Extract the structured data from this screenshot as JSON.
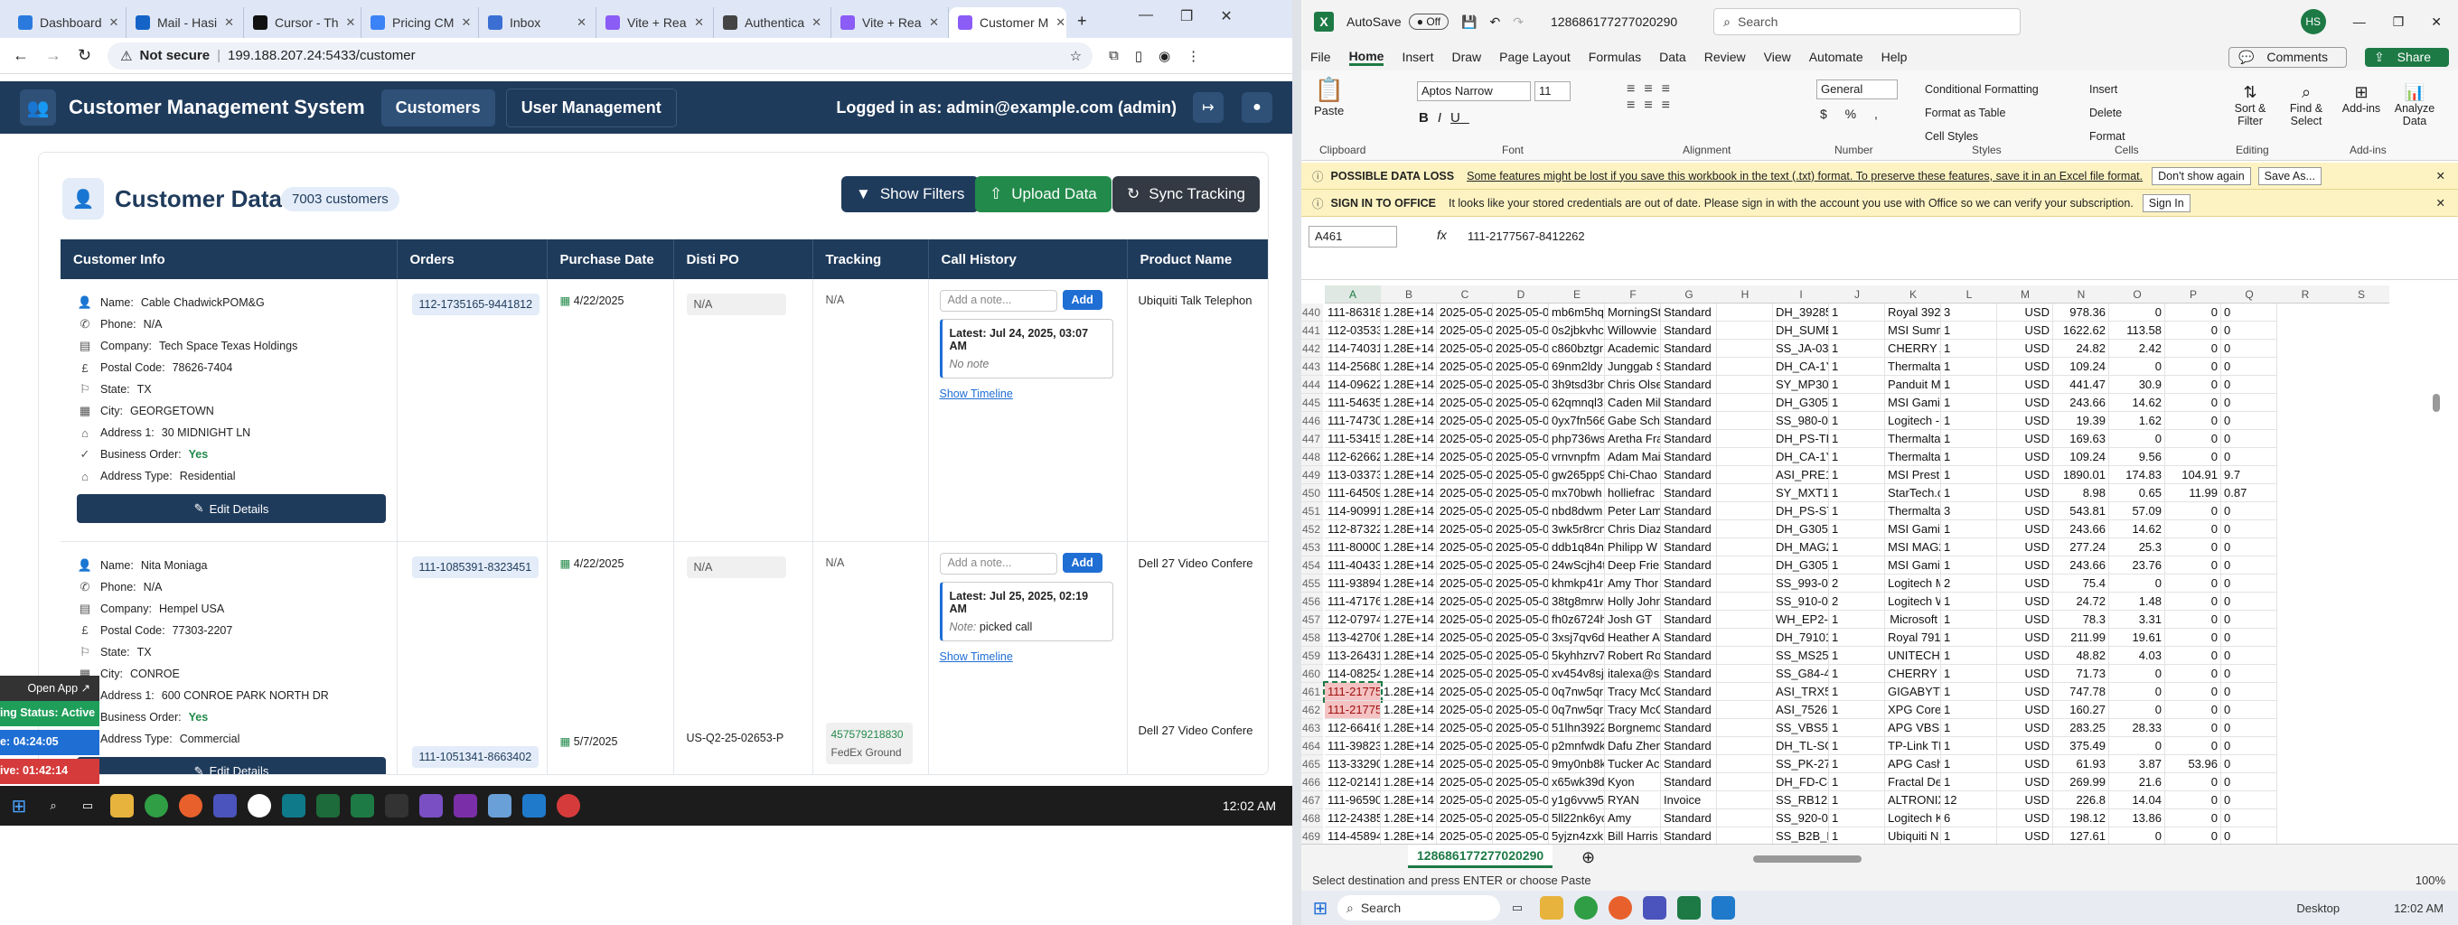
{
  "browser": {
    "tabs": [
      {
        "label": "Dashboard",
        "color": "#2a7ade"
      },
      {
        "label": "Mail - Hasi",
        "color": "#1464c8"
      },
      {
        "label": "Cursor - Th",
        "color": "#111111"
      },
      {
        "label": "Pricing CM",
        "color": "#3b82f6"
      },
      {
        "label": "Inbox",
        "color": "#3b6fd4"
      },
      {
        "label": "Vite + Rea",
        "color": "#8b5cf6"
      },
      {
        "label": "Authentica",
        "color": "#444444"
      },
      {
        "label": "Vite + Rea",
        "color": "#8b5cf6"
      },
      {
        "label": "Customer M",
        "color": "#8b5cf6"
      }
    ],
    "not_secure": "Not secure",
    "url": "199.188.207.24:5433/customer"
  },
  "app": {
    "title": "Customer Management System",
    "nav": [
      "Customers",
      "User Management"
    ],
    "logged_in": "Logged in as: admin@example.com (admin)"
  },
  "page": {
    "title": "Customer Data",
    "count": "7003 customers",
    "buttons": {
      "filters": "Show Filters",
      "upload": "Upload Data",
      "sync": "Sync Tracking"
    },
    "columns": [
      "Customer Info",
      "Orders",
      "Purchase Date",
      "Disti PO",
      "Tracking",
      "Call History",
      "Product Name"
    ],
    "note_placeholder": "Add a note...",
    "add_label": "Add",
    "latest_label": "Latest:",
    "show_timeline": "Show Timeline",
    "edit_label": "Edit Details",
    "field_labels": [
      "Name:",
      "Phone:",
      "Company:",
      "Postal Code:",
      "State:",
      "City:",
      "Address 1:",
      "Business Order:",
      "Address Type:"
    ],
    "rows": [
      {
        "name": "Cable ChadwickPOM&G",
        "phone": "N/A",
        "company": "Tech Space Texas Holdings",
        "postal": "78626-7404",
        "state": "TX",
        "city": "GEORGETOWN",
        "address": "30 MIDNIGHT LN",
        "business": "Yes",
        "addrtype": "Residential",
        "order": "112-1735165-9441812",
        "date": "4/22/2025",
        "disti": "N/A",
        "tracking": "N/A",
        "latest_date": "Jul 24, 2025, 03:07 AM",
        "latest_note": "No note",
        "product": "Ubiquiti Talk Telephon"
      },
      {
        "name": "Nita Moniaga",
        "phone": "N/A",
        "company": "Hempel USA",
        "postal": "77303-2207",
        "state": "TX",
        "city": "CONROE",
        "address": "600 CONROE PARK NORTH DR",
        "business": "Yes",
        "addrtype": "Commercial",
        "order": "111-1085391-8323451",
        "date": "4/22/2025",
        "disti": "N/A",
        "tracking": "N/A",
        "latest_date": "Jul 25, 2025, 02:19 AM",
        "latest_note_label": "Note:",
        "latest_note": "picked call",
        "product": "Dell 27 Video Confere",
        "order2": "111-1051341-8663402",
        "date2": "5/7/2025",
        "disti2": "US-Q2-25-02653-P",
        "tracking2": "457579218830",
        "carrier2": "FedEx Ground",
        "product2": "Dell 27 Video Confere"
      }
    ]
  },
  "overlay": {
    "open_app": "Open App",
    "status": "ing Status: Active",
    "t1": "e: 04:24:05",
    "t2": "ive: 01:42:14"
  },
  "taskbar_time": "12:02 AM",
  "excel": {
    "autosave": "AutoSave",
    "toggle": "Off",
    "filename": "128686177277020290",
    "search": "Search",
    "user": "HS",
    "menu": [
      "File",
      "Home",
      "Insert",
      "Draw",
      "Page Layout",
      "Formulas",
      "Data",
      "Review",
      "View",
      "Automate",
      "Help"
    ],
    "comments": "Comments",
    "share": "Share",
    "font": "Aptos Narrow",
    "size": "11",
    "numfmt": "General",
    "groups": [
      "Clipboard",
      "Font",
      "Alignment",
      "Number",
      "Styles",
      "Cells",
      "Editing",
      "Add-ins"
    ],
    "styles": [
      "Conditional Formatting",
      "Format as Table",
      "Cell Styles"
    ],
    "cells": [
      "Insert",
      "Delete",
      "Format"
    ],
    "editing": [
      "Sort & Filter",
      "Find & Select"
    ],
    "addins": [
      "Add-ins",
      "Analyze Data"
    ],
    "paste": "Paste",
    "msg1": {
      "title": "POSSIBLE DATA LOSS",
      "text": "Some features might be lost if you save this workbook in the text (.txt) format. To preserve these features, save it in an Excel file format.",
      "b1": "Don't show again",
      "b2": "Save As..."
    },
    "msg2": {
      "title": "SIGN IN TO OFFICE",
      "text": "It looks like your stored credentials are out of date. Please sign in with the account you use with Office so we can verify your subscription.",
      "b1": "Sign In"
    },
    "namebox": "A461",
    "formula": "111-2177567-8412262",
    "col_letters": [
      "A",
      "B",
      "C",
      "D",
      "E",
      "F",
      "G",
      "H",
      "I",
      "J",
      "K",
      "L",
      "M",
      "N",
      "O",
      "P",
      "Q",
      "R",
      "S"
    ],
    "rows": [
      [
        "440",
        "111-86318",
        "1.28E+14",
        "2025-05-0",
        "2025-05-0",
        "mb6m5hq",
        "MorningSt",
        "Standard",
        "",
        "DH_39285",
        "1",
        "Royal 392",
        "3",
        "USD",
        "978.36",
        "0",
        "0",
        "0"
      ],
      [
        "441",
        "112-03533",
        "1.28E+14",
        "2025-05-0",
        "2025-05-0",
        "0s2jbkvhc",
        "Willowvie",
        "Standard",
        "",
        "DH_SUME",
        "1",
        "MSI Summ",
        "1",
        "USD",
        "1622.62",
        "113.58",
        "0",
        "0"
      ],
      [
        "442",
        "114-74031",
        "1.28E+14",
        "2025-05-0",
        "2025-05-0",
        "c860bztgr",
        "Academic",
        "Standard",
        "",
        "SS_JA-033",
        "1",
        "CHERRY A",
        "1",
        "USD",
        "24.82",
        "2.42",
        "0",
        "0"
      ],
      [
        "443",
        "114-25680",
        "1.28E+14",
        "2025-05-0",
        "2025-05-0",
        "69nm2ldy",
        "Junggab S",
        "Standard",
        "",
        "DH_CA-1Y",
        "1",
        "Thermalta",
        "1",
        "USD",
        "109.24",
        "0",
        "0",
        "0"
      ],
      [
        "444",
        "114-09622",
        "1.28E+14",
        "2025-05-0",
        "2025-05-0",
        "3h9tsd3br",
        "Chris Olse",
        "Standard",
        "",
        "SY_MP300",
        "1",
        "Panduit M",
        "1",
        "USD",
        "441.47",
        "30.9",
        "0",
        "0"
      ],
      [
        "445",
        "111-54635",
        "1.28E+14",
        "2025-05-0",
        "2025-05-0",
        "62qmnql3",
        "Caden Mil",
        "Standard",
        "",
        "DH_G3050",
        "1",
        "MSI Gamin",
        "1",
        "USD",
        "243.66",
        "14.62",
        "0",
        "0"
      ],
      [
        "446",
        "111-74730",
        "1.28E+14",
        "2025-05-0",
        "2025-05-0",
        "0yx7fn566",
        "Gabe Sch",
        "Standard",
        "",
        "SS_980-00",
        "1",
        "Logitech -",
        "1",
        "USD",
        "19.39",
        "1.62",
        "0",
        "0"
      ],
      [
        "447",
        "111-53415",
        "1.28E+14",
        "2025-05-0",
        "2025-05-0",
        "php736ws",
        "Aretha Fra",
        "Standard",
        "",
        "DH_PS-TP",
        "1",
        "Thermalta",
        "1",
        "USD",
        "169.63",
        "0",
        "0",
        "0"
      ],
      [
        "448",
        "112-62662",
        "1.28E+14",
        "2025-05-0",
        "2025-05-0",
        "vrnvnpfm",
        "Adam Mai",
        "Standard",
        "",
        "DH_CA-1Y",
        "1",
        "Thermalta",
        "1",
        "USD",
        "109.24",
        "9.56",
        "0",
        "0"
      ],
      [
        "449",
        "113-03373",
        "1.28E+14",
        "2025-05-0",
        "2025-05-0",
        "gw265pp9",
        "Chi-Chao",
        "Standard",
        "",
        "ASI_PRE16",
        "1",
        "MSI Presti",
        "1",
        "USD",
        "1890.01",
        "174.83",
        "104.91",
        "9.7"
      ],
      [
        "450",
        "111-64509",
        "1.28E+14",
        "2025-05-0",
        "2025-05-0",
        "mx70bwh",
        "holliefrac",
        "Standard",
        "",
        "SY_MXT10",
        "1",
        "StarTech.c",
        "1",
        "USD",
        "8.98",
        "0.65",
        "11.99",
        "0.87"
      ],
      [
        "451",
        "114-90991",
        "1.28E+14",
        "2025-05-0",
        "2025-05-0",
        "nbd8dwm",
        "Peter Lam",
        "Standard",
        "",
        "DH_PS-STI",
        "1",
        "Thermalta",
        "3",
        "USD",
        "543.81",
        "57.09",
        "0",
        "0"
      ],
      [
        "452",
        "112-87322",
        "1.28E+14",
        "2025-05-0",
        "2025-05-0",
        "3wk5r8rcn",
        "Chris Diaz",
        "Standard",
        "",
        "DH_G3050",
        "1",
        "MSI Gamin",
        "1",
        "USD",
        "243.66",
        "14.62",
        "0",
        "0"
      ],
      [
        "453",
        "111-80000",
        "1.28E+14",
        "2025-05-0",
        "2025-05-0",
        "ddb1q84n",
        "Philipp W",
        "Standard",
        "",
        "DH_MAG2",
        "1",
        "MSI MAG2",
        "1",
        "USD",
        "277.24",
        "25.3",
        "0",
        "0"
      ],
      [
        "454",
        "111-40433",
        "1.28E+14",
        "2025-05-0",
        "2025-05-0",
        "24wScjh4t",
        "Deep Frie",
        "Standard",
        "",
        "DH_G3050",
        "1",
        "MSI Gamin",
        "1",
        "USD",
        "243.66",
        "23.76",
        "0",
        "0"
      ],
      [
        "455",
        "111-93894",
        "1.28E+14",
        "2025-05-0",
        "2025-05-0",
        "khmkp41r",
        "Amy Thor",
        "Standard",
        "",
        "SS_993-00",
        "2",
        "Logitech M",
        "2",
        "USD",
        "75.4",
        "0",
        "0",
        "0"
      ],
      [
        "456",
        "111-47176",
        "1.28E+14",
        "2025-05-0",
        "2025-05-0",
        "38tg8mrw",
        "Holly Johr",
        "Standard",
        "",
        "SS_910-00",
        "2",
        "Logitech W",
        "1",
        "USD",
        "24.72",
        "1.48",
        "0",
        "0"
      ],
      [
        "457",
        "112-07974",
        "1.27E+14",
        "2025-05-0",
        "2025-05-0",
        "fh0z6724h",
        "Josh GT",
        "Standard",
        "",
        "WH_EP2-0",
        "1",
        "Microsoft",
        "1",
        "USD",
        "78.3",
        "3.31",
        "0",
        "0"
      ],
      [
        "458",
        "113-42706",
        "1.28E+14",
        "2025-05-0",
        "2025-05-0",
        "3xsj7qv6d",
        "Heather A",
        "Standard",
        "",
        "DH_79101",
        "1",
        "Royal 791",
        "1",
        "USD",
        "211.99",
        "19.61",
        "0",
        "0"
      ],
      [
        "459",
        "113-26431",
        "1.28E+14",
        "2025-05-0",
        "2025-05-0",
        "5kyhhzrv7",
        "Robert Ro",
        "Standard",
        "",
        "SS_MS250",
        "1",
        "UNITECH A",
        "1",
        "USD",
        "48.82",
        "4.03",
        "0",
        "0"
      ],
      [
        "460",
        "114-08254",
        "1.28E+14",
        "2025-05-0",
        "2025-05-0",
        "xv454v8sjt",
        "italexa@s",
        "Standard",
        "",
        "SS_G84-41",
        "1",
        "CHERRY M",
        "1",
        "USD",
        "71.73",
        "0",
        "0",
        "0"
      ],
      [
        "461",
        "111-21775",
        "1.28E+14",
        "2025-05-0",
        "2025-05-0",
        "0q7nw5qr",
        "Tracy McC",
        "Standard",
        "",
        "ASI_TRX50",
        "1",
        "GIGABYTE",
        "1",
        "USD",
        "747.78",
        "0",
        "0",
        "0"
      ],
      [
        "462",
        "111-21775",
        "1.28E+14",
        "2025-05-0",
        "2025-05-0",
        "0q7nw5qr",
        "Tracy McC",
        "Standard",
        "",
        "ASI_75261",
        "1",
        "XPG Core",
        "1",
        "USD",
        "160.27",
        "0",
        "0",
        "0"
      ],
      [
        "463",
        "112-66416",
        "1.28E+14",
        "2025-05-0",
        "2025-05-0",
        "51lhn3922",
        "Borgnemc",
        "Standard",
        "",
        "SS_VBS55",
        "1",
        "APG VBS5",
        "1",
        "USD",
        "283.25",
        "28.33",
        "0",
        "0"
      ],
      [
        "464",
        "111-39823",
        "1.28E+14",
        "2025-05-0",
        "2025-05-0",
        "p2mnfwdk",
        "Dafu Zhen",
        "Standard",
        "",
        "DH_TL-SG",
        "1",
        "TP-Link TL",
        "1",
        "USD",
        "375.49",
        "0",
        "0",
        "0"
      ],
      [
        "465",
        "113-33290",
        "1.28E+14",
        "2025-05-0",
        "2025-05-0",
        "9my0nb8k",
        "Tucker Ac",
        "Standard",
        "",
        "SS_PK-27-",
        "1",
        "APG Cash",
        "1",
        "USD",
        "61.93",
        "3.87",
        "53.96",
        "0"
      ],
      [
        "466",
        "112-02141",
        "1.28E+14",
        "2025-05-0",
        "2025-05-0",
        "x65wk39dr",
        "Kyon",
        "Standard",
        "",
        "DH_FD-C-",
        "1",
        "Fractal De",
        "1",
        "USD",
        "269.99",
        "21.6",
        "0",
        "0"
      ],
      [
        "467",
        "111-96590",
        "1.28E+14",
        "2025-05-0",
        "2025-05-0",
        "y1g6vvw5k",
        "RYAN",
        "Invoice",
        "",
        "SS_RB1224",
        "1",
        "ALTRONIX",
        "12",
        "USD",
        "226.8",
        "14.04",
        "0",
        "0"
      ],
      [
        "468",
        "112-24385",
        "1.28E+14",
        "2025-05-0",
        "2025-05-0",
        "5ll22nk6yc",
        "Amy",
        "Standard",
        "",
        "SS_920-00",
        "1",
        "Logitech K",
        "6",
        "USD",
        "198.12",
        "13.86",
        "0",
        "0"
      ],
      [
        "469",
        "114-45894",
        "1.28E+14",
        "2025-05-0",
        "2025-05-0",
        "5yjzn4zxk",
        "Bill Harris",
        "Standard",
        "",
        "SS_B2B_N",
        "1",
        "Ubiquiti N",
        "1",
        "USD",
        "127.61",
        "0",
        "0",
        "0"
      ]
    ],
    "sheet_tab": "128686177277020290",
    "status": "Select destination and press ENTER or choose Paste",
    "zoom": "100%",
    "desktop": "Desktop",
    "time": "12:02 AM"
  }
}
